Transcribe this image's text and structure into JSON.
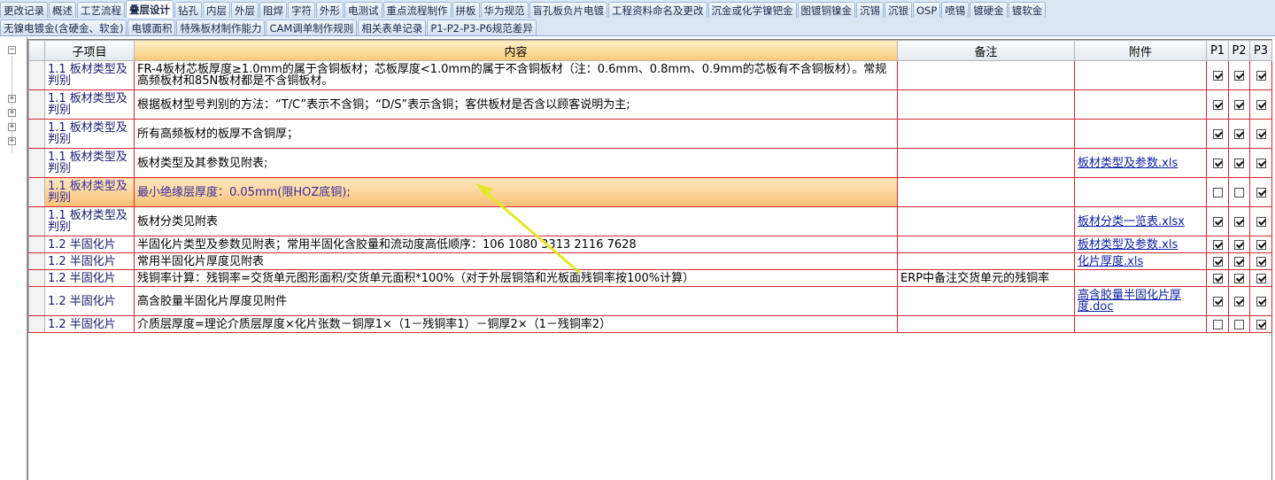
{
  "tabs_row1": [
    "更改记录",
    "概述",
    "工艺流程",
    "叠层设计",
    "钻孔",
    "内层",
    "外层",
    "阻焊",
    "字符",
    "外形",
    "电测试",
    "重点流程制作",
    "拼板",
    "华为规范",
    "盲孔板负片电镀",
    "工程资料命名及更改",
    "沉金或化学镍钯金",
    "图镀铜镍金",
    "沉锡",
    "沉银",
    "OSP",
    "喷锡",
    "镀硬金",
    "镀软金"
  ],
  "tabs_row2": [
    "无镍电镀金(含硬金、软金)",
    "电镀面积",
    "特殊板材制作能力",
    "CAM调单制作规则",
    "相关表单记录",
    "P1-P2-P3-P6规范差异"
  ],
  "active_tab": "叠层设计",
  "tree": {
    "expand_symbol": "+",
    "collapse_symbol": "−"
  },
  "grid": {
    "headers": {
      "sub": "子项目",
      "content": "内容",
      "note": "备注",
      "attachment": "附件",
      "p1": "P1",
      "p2": "P2",
      "p3": "P3"
    },
    "rows": [
      {
        "sub": "1.1 板材类型及判别",
        "content": "FR-4板材芯板厚度≥1.0mm的属于含铜板材；芯板厚度<1.0mm的属于不含铜板材（注：0.6mm、0.8mm、0.9mm的芯板有不含铜板材）。常规高频板材和85N板材都是不含铜板材。",
        "note": "",
        "attachment": "",
        "p1": true,
        "p2": true,
        "p3": true
      },
      {
        "sub": "1.1 板材类型及判别",
        "content": "根据板材型号判别的方法：“T/C”表示不含铜；“D/S”表示含铜；客供板材是否含以顾客说明为主;",
        "note": "",
        "attachment": "",
        "p1": true,
        "p2": true,
        "p3": true
      },
      {
        "sub": "1.1 板材类型及判别",
        "content": "所有高频板材的板厚不含铜厚；",
        "note": "",
        "attachment": "",
        "p1": true,
        "p2": true,
        "p3": true
      },
      {
        "sub": "1.1 板材类型及判别",
        "content": "板材类型及其参数见附表;",
        "note": "",
        "attachment": "板材类型及参数.xls",
        "p1": true,
        "p2": true,
        "p3": true
      },
      {
        "sub": "1.1 板材类型及判别",
        "content": "最小绝缘层厚度：0.05mm(限HOZ底铜);",
        "note": "",
        "attachment": "",
        "p1": false,
        "p2": false,
        "p3": true
      },
      {
        "sub": "1.1 板材类型及判别",
        "content": "板材分类见附表",
        "note": "",
        "attachment": "板材分类一览表.xlsx",
        "p1": true,
        "p2": true,
        "p3": true
      },
      {
        "sub": "1.2 半固化片",
        "content": "半固化片类型及参数见附表；常用半固化含胶量和流动度高低顺序：106 1080  3313  2116  7628",
        "note": "",
        "attachment": "板材类型及参数.xls",
        "p1": true,
        "p2": true,
        "p3": true
      },
      {
        "sub": "1.2 半固化片",
        "content": "常用半固化片厚度见附表",
        "note": "",
        "attachment": "化片厚度.xls",
        "p1": true,
        "p2": true,
        "p3": true
      },
      {
        "sub": "1.2 半固化片",
        "content": "残铜率计算：残铜率=交货单元图形面积/交货单元面积*100%（对于外层铜箔和光板面残铜率按100%计算）",
        "note": "ERP中备注交货单元的残铜率",
        "attachment": "",
        "p1": true,
        "p2": true,
        "p3": true
      },
      {
        "sub": "1.2 半固化片",
        "content": "高含胶量半固化片厚度见附件",
        "note": "",
        "attachment": "高含胶量半固化片厚度.doc",
        "p1": true,
        "p2": true,
        "p3": true
      },
      {
        "sub": "1.2 半固化片",
        "content": "介质层厚度=理论介质层厚度×化片张数－铜厚1×（1－残铜率1）－铜厚2×（1－残铜率2）",
        "note": "",
        "attachment": "",
        "p1": false,
        "p2": false,
        "p3": true
      }
    ]
  },
  "colors": {
    "grid_line": "#d9272e",
    "highlight": "#f8c176",
    "tab_bg": "#dbe6f4",
    "arrow": "#e6e62a"
  }
}
